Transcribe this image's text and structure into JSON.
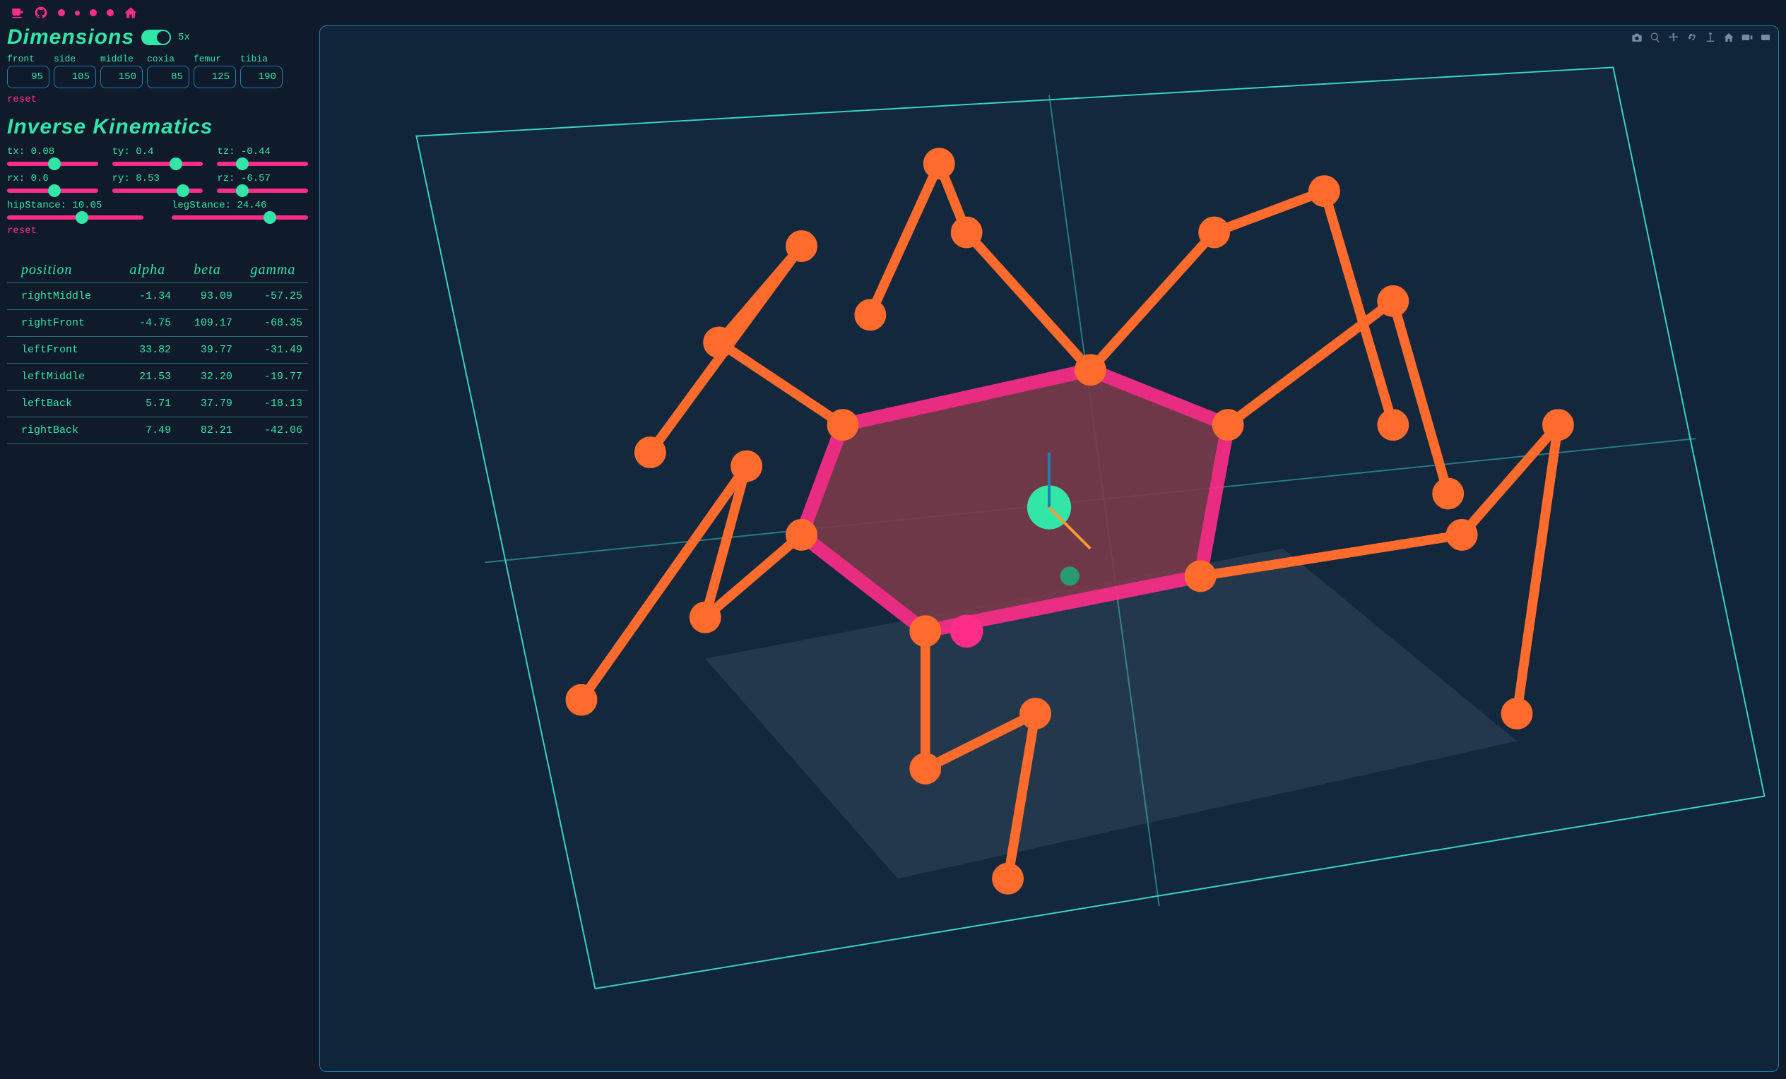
{
  "navbar": {
    "icons": [
      "coffee",
      "github",
      "dot",
      "dot",
      "dot",
      "dot",
      "home"
    ]
  },
  "dimensions": {
    "title": "Dimensions",
    "toggle_label": "5x",
    "fields": [
      {
        "label": "front",
        "value": "95"
      },
      {
        "label": "side",
        "value": "105"
      },
      {
        "label": "middle",
        "value": "150"
      },
      {
        "label": "coxia",
        "value": "85"
      },
      {
        "label": "femur",
        "value": "125"
      },
      {
        "label": "tibia",
        "value": "190"
      }
    ],
    "reset_label": "reset"
  },
  "ik": {
    "title": "Inverse Kinematics",
    "sliders_row1": [
      {
        "label": "tx",
        "value": "0.08",
        "pos": 52
      },
      {
        "label": "ty",
        "value": "0.4",
        "pos": 70
      },
      {
        "label": "tz",
        "value": "-0.44",
        "pos": 28
      }
    ],
    "sliders_row2": [
      {
        "label": "rx",
        "value": "0.6",
        "pos": 52
      },
      {
        "label": "ry",
        "value": "8.53",
        "pos": 78
      },
      {
        "label": "rz",
        "value": "-6.57",
        "pos": 28
      }
    ],
    "sliders_row3": [
      {
        "label": "hipStance",
        "value": "10.05",
        "pos": 55
      },
      {
        "label": "legStance",
        "value": "24.46",
        "pos": 72
      }
    ],
    "reset_label": "reset"
  },
  "table": {
    "headers": [
      "position",
      "alpha",
      "beta",
      "gamma"
    ],
    "rows": [
      {
        "position": "rightMiddle",
        "alpha": "-1.34",
        "beta": "93.09",
        "gamma": "-57.25"
      },
      {
        "position": "rightFront",
        "alpha": "-4.75",
        "beta": "109.17",
        "gamma": "-68.35"
      },
      {
        "position": "leftFront",
        "alpha": "33.82",
        "beta": "39.77",
        "gamma": "-31.49"
      },
      {
        "position": "leftMiddle",
        "alpha": "21.53",
        "beta": "32.20",
        "gamma": "-19.77"
      },
      {
        "position": "leftBack",
        "alpha": "5.71",
        "beta": "37.79",
        "gamma": "-18.13"
      },
      {
        "position": "rightBack",
        "alpha": "7.49",
        "beta": "82.21",
        "gamma": "-42.06"
      }
    ]
  },
  "viz": {
    "toolbar": [
      "camera",
      "zoom",
      "pan",
      "rotate",
      "reset-axes",
      "home",
      "video",
      "save"
    ]
  }
}
